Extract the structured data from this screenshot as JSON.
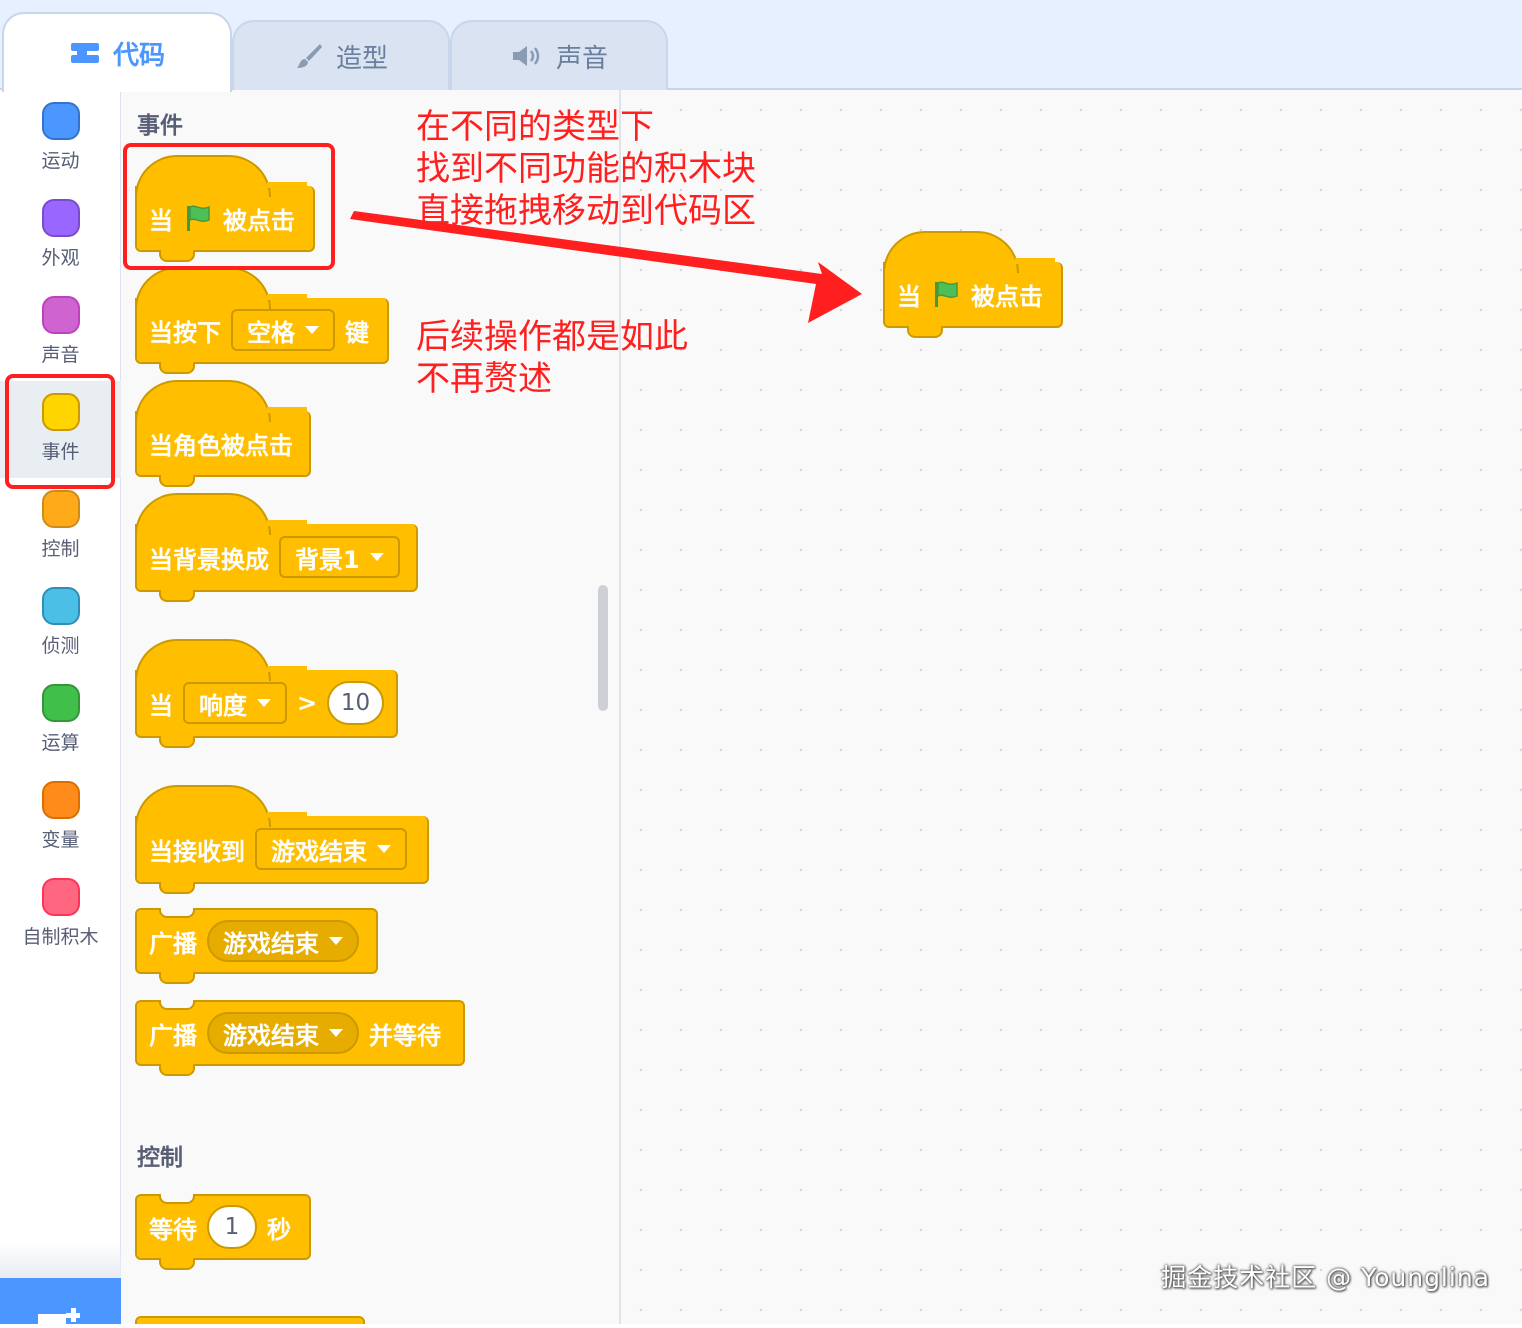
{
  "tabs": [
    {
      "label": "代码",
      "icon": "code-icon",
      "active": true
    },
    {
      "label": "造型",
      "icon": "brush-icon",
      "active": false
    },
    {
      "label": "声音",
      "icon": "speaker-icon",
      "active": false
    }
  ],
  "categories": [
    {
      "label": "运动",
      "color": "#4c97ff",
      "selected": false
    },
    {
      "label": "外观",
      "color": "#9966ff",
      "selected": false
    },
    {
      "label": "声音",
      "color": "#cf63cf",
      "selected": false
    },
    {
      "label": "事件",
      "color": "#ffd500",
      "selected": true
    },
    {
      "label": "控制",
      "color": "#ffab19",
      "selected": false
    },
    {
      "label": "侦测",
      "color": "#4cbfe6",
      "selected": false
    },
    {
      "label": "运算",
      "color": "#40bf4a",
      "selected": false
    },
    {
      "label": "变量",
      "color": "#ff8c1a",
      "selected": false
    },
    {
      "label": "自制积木",
      "color": "#ff6680",
      "selected": false
    }
  ],
  "palette": {
    "events_header": "事件",
    "control_header": "控制",
    "blocks": {
      "flag_when": "当",
      "flag_clicked": "被点击",
      "key_when": "当按下",
      "key_value": "空格",
      "key_suffix": "键",
      "sprite_clicked": "当角色被点击",
      "backdrop_when": "当背景换成",
      "backdrop_value": "背景1",
      "sensor_when": "当",
      "sensor_value": "响度",
      "sensor_op": ">",
      "sensor_number": "10",
      "receive_when": "当接收到",
      "receive_value": "游戏结束",
      "broadcast": "广播",
      "broadcast_value": "游戏结束",
      "broadcast_wait": "广播",
      "broadcast_wait_value": "游戏结束",
      "broadcast_wait_suffix": "并等待",
      "wait": "等待",
      "wait_number": "1",
      "wait_unit": "秒"
    }
  },
  "workspace_block": {
    "when": "当",
    "clicked": "被点击"
  },
  "annotations": {
    "note1": "在不同的类型下\n找到不同功能的积木块\n直接拖拽移动到代码区",
    "note2": "后续操作都是如此\n不再赘述"
  },
  "watermark": "掘金技术社区 @ Younglina",
  "colors": {
    "event_block": "#ffbf00",
    "event_border": "#cc9900",
    "annotation_red": "#ff1f1f",
    "accent_blue": "#4c97ff"
  }
}
